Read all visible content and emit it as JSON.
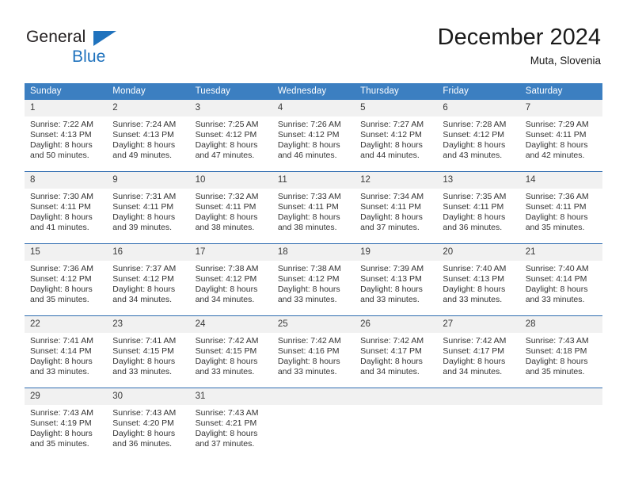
{
  "brand": {
    "name_part1": "General",
    "name_part2": "Blue",
    "logo_icon": "triangle-logo-icon"
  },
  "header": {
    "title": "December 2024",
    "subtitle": "Muta, Slovenia"
  },
  "colors": {
    "header_blue": "#3c7fc1",
    "row_divider_blue": "#2f6cb0",
    "daynum_band": "#f1f1f1",
    "brand_blue": "#1f72bd",
    "text": "#333333"
  },
  "weekday_headers": [
    "Sunday",
    "Monday",
    "Tuesday",
    "Wednesday",
    "Thursday",
    "Friday",
    "Saturday"
  ],
  "weeks": [
    {
      "days": [
        {
          "num": "1",
          "sunrise": "Sunrise: 7:22 AM",
          "sunset": "Sunset: 4:13 PM",
          "daylight1": "Daylight: 8 hours",
          "daylight2": "and 50 minutes."
        },
        {
          "num": "2",
          "sunrise": "Sunrise: 7:24 AM",
          "sunset": "Sunset: 4:13 PM",
          "daylight1": "Daylight: 8 hours",
          "daylight2": "and 49 minutes."
        },
        {
          "num": "3",
          "sunrise": "Sunrise: 7:25 AM",
          "sunset": "Sunset: 4:12 PM",
          "daylight1": "Daylight: 8 hours",
          "daylight2": "and 47 minutes."
        },
        {
          "num": "4",
          "sunrise": "Sunrise: 7:26 AM",
          "sunset": "Sunset: 4:12 PM",
          "daylight1": "Daylight: 8 hours",
          "daylight2": "and 46 minutes."
        },
        {
          "num": "5",
          "sunrise": "Sunrise: 7:27 AM",
          "sunset": "Sunset: 4:12 PM",
          "daylight1": "Daylight: 8 hours",
          "daylight2": "and 44 minutes."
        },
        {
          "num": "6",
          "sunrise": "Sunrise: 7:28 AM",
          "sunset": "Sunset: 4:12 PM",
          "daylight1": "Daylight: 8 hours",
          "daylight2": "and 43 minutes."
        },
        {
          "num": "7",
          "sunrise": "Sunrise: 7:29 AM",
          "sunset": "Sunset: 4:11 PM",
          "daylight1": "Daylight: 8 hours",
          "daylight2": "and 42 minutes."
        }
      ]
    },
    {
      "days": [
        {
          "num": "8",
          "sunrise": "Sunrise: 7:30 AM",
          "sunset": "Sunset: 4:11 PM",
          "daylight1": "Daylight: 8 hours",
          "daylight2": "and 41 minutes."
        },
        {
          "num": "9",
          "sunrise": "Sunrise: 7:31 AM",
          "sunset": "Sunset: 4:11 PM",
          "daylight1": "Daylight: 8 hours",
          "daylight2": "and 39 minutes."
        },
        {
          "num": "10",
          "sunrise": "Sunrise: 7:32 AM",
          "sunset": "Sunset: 4:11 PM",
          "daylight1": "Daylight: 8 hours",
          "daylight2": "and 38 minutes."
        },
        {
          "num": "11",
          "sunrise": "Sunrise: 7:33 AM",
          "sunset": "Sunset: 4:11 PM",
          "daylight1": "Daylight: 8 hours",
          "daylight2": "and 38 minutes."
        },
        {
          "num": "12",
          "sunrise": "Sunrise: 7:34 AM",
          "sunset": "Sunset: 4:11 PM",
          "daylight1": "Daylight: 8 hours",
          "daylight2": "and 37 minutes."
        },
        {
          "num": "13",
          "sunrise": "Sunrise: 7:35 AM",
          "sunset": "Sunset: 4:11 PM",
          "daylight1": "Daylight: 8 hours",
          "daylight2": "and 36 minutes."
        },
        {
          "num": "14",
          "sunrise": "Sunrise: 7:36 AM",
          "sunset": "Sunset: 4:11 PM",
          "daylight1": "Daylight: 8 hours",
          "daylight2": "and 35 minutes."
        }
      ]
    },
    {
      "days": [
        {
          "num": "15",
          "sunrise": "Sunrise: 7:36 AM",
          "sunset": "Sunset: 4:12 PM",
          "daylight1": "Daylight: 8 hours",
          "daylight2": "and 35 minutes."
        },
        {
          "num": "16",
          "sunrise": "Sunrise: 7:37 AM",
          "sunset": "Sunset: 4:12 PM",
          "daylight1": "Daylight: 8 hours",
          "daylight2": "and 34 minutes."
        },
        {
          "num": "17",
          "sunrise": "Sunrise: 7:38 AM",
          "sunset": "Sunset: 4:12 PM",
          "daylight1": "Daylight: 8 hours",
          "daylight2": "and 34 minutes."
        },
        {
          "num": "18",
          "sunrise": "Sunrise: 7:38 AM",
          "sunset": "Sunset: 4:12 PM",
          "daylight1": "Daylight: 8 hours",
          "daylight2": "and 33 minutes."
        },
        {
          "num": "19",
          "sunrise": "Sunrise: 7:39 AM",
          "sunset": "Sunset: 4:13 PM",
          "daylight1": "Daylight: 8 hours",
          "daylight2": "and 33 minutes."
        },
        {
          "num": "20",
          "sunrise": "Sunrise: 7:40 AM",
          "sunset": "Sunset: 4:13 PM",
          "daylight1": "Daylight: 8 hours",
          "daylight2": "and 33 minutes."
        },
        {
          "num": "21",
          "sunrise": "Sunrise: 7:40 AM",
          "sunset": "Sunset: 4:14 PM",
          "daylight1": "Daylight: 8 hours",
          "daylight2": "and 33 minutes."
        }
      ]
    },
    {
      "days": [
        {
          "num": "22",
          "sunrise": "Sunrise: 7:41 AM",
          "sunset": "Sunset: 4:14 PM",
          "daylight1": "Daylight: 8 hours",
          "daylight2": "and 33 minutes."
        },
        {
          "num": "23",
          "sunrise": "Sunrise: 7:41 AM",
          "sunset": "Sunset: 4:15 PM",
          "daylight1": "Daylight: 8 hours",
          "daylight2": "and 33 minutes."
        },
        {
          "num": "24",
          "sunrise": "Sunrise: 7:42 AM",
          "sunset": "Sunset: 4:15 PM",
          "daylight1": "Daylight: 8 hours",
          "daylight2": "and 33 minutes."
        },
        {
          "num": "25",
          "sunrise": "Sunrise: 7:42 AM",
          "sunset": "Sunset: 4:16 PM",
          "daylight1": "Daylight: 8 hours",
          "daylight2": "and 33 minutes."
        },
        {
          "num": "26",
          "sunrise": "Sunrise: 7:42 AM",
          "sunset": "Sunset: 4:17 PM",
          "daylight1": "Daylight: 8 hours",
          "daylight2": "and 34 minutes."
        },
        {
          "num": "27",
          "sunrise": "Sunrise: 7:42 AM",
          "sunset": "Sunset: 4:17 PM",
          "daylight1": "Daylight: 8 hours",
          "daylight2": "and 34 minutes."
        },
        {
          "num": "28",
          "sunrise": "Sunrise: 7:43 AM",
          "sunset": "Sunset: 4:18 PM",
          "daylight1": "Daylight: 8 hours",
          "daylight2": "and 35 minutes."
        }
      ]
    },
    {
      "days": [
        {
          "num": "29",
          "sunrise": "Sunrise: 7:43 AM",
          "sunset": "Sunset: 4:19 PM",
          "daylight1": "Daylight: 8 hours",
          "daylight2": "and 35 minutes."
        },
        {
          "num": "30",
          "sunrise": "Sunrise: 7:43 AM",
          "sunset": "Sunset: 4:20 PM",
          "daylight1": "Daylight: 8 hours",
          "daylight2": "and 36 minutes."
        },
        {
          "num": "31",
          "sunrise": "Sunrise: 7:43 AM",
          "sunset": "Sunset: 4:21 PM",
          "daylight1": "Daylight: 8 hours",
          "daylight2": "and 37 minutes."
        },
        {
          "num": "",
          "sunrise": "",
          "sunset": "",
          "daylight1": "",
          "daylight2": ""
        },
        {
          "num": "",
          "sunrise": "",
          "sunset": "",
          "daylight1": "",
          "daylight2": ""
        },
        {
          "num": "",
          "sunrise": "",
          "sunset": "",
          "daylight1": "",
          "daylight2": ""
        },
        {
          "num": "",
          "sunrise": "",
          "sunset": "",
          "daylight1": "",
          "daylight2": ""
        }
      ]
    }
  ]
}
